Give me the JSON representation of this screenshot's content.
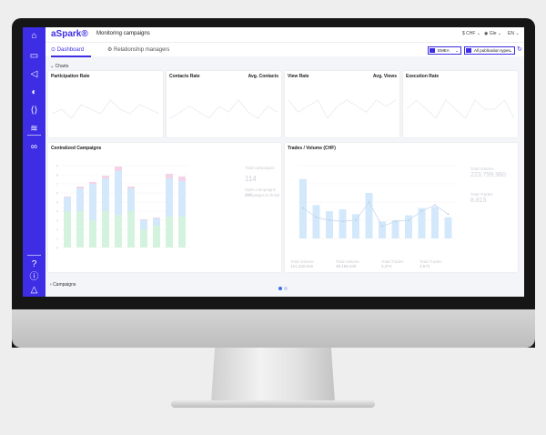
{
  "app": {
    "brand": "aSpark®",
    "page_title": "Monitoring campaigns",
    "currency": "CHF",
    "user": "Gle",
    "language": "EN"
  },
  "sidebar": {
    "icons": [
      "home-icon",
      "book-icon",
      "megaphone-icon",
      "chart-pie-icon",
      "code-icon",
      "analytics-icon",
      "people-icon",
      "help-icon",
      "info-icon",
      "warning-icon"
    ]
  },
  "tabs": [
    {
      "label": "Dashboard",
      "active": true
    },
    {
      "label": "Relationship managers",
      "active": false
    }
  ],
  "filters": {
    "region": "EMEA",
    "publication_types": "All publication types"
  },
  "sections": {
    "charts": "Charts",
    "campaigns": "Campaigns"
  },
  "rate_panels": [
    {
      "title": "Participation Rate",
      "right": ""
    },
    {
      "title": "Contacts Rate",
      "right": "Avg. Contacts"
    },
    {
      "title": "View Rate",
      "right": "Avg. Views"
    },
    {
      "title": "Execution Rate",
      "right": ""
    }
  ],
  "centralized": {
    "title": "Centralized Campaigns",
    "side_label": "Total campaigns",
    "side_value": "114",
    "side_note_1": "Open campaigns and",
    "side_note_2": "campaigns to finish"
  },
  "trades": {
    "title": "Trades / Volume (CHF)",
    "side_label_1": "Total Volume",
    "side_value_1": "223,799,960",
    "side_label_2": "Total Trades",
    "side_value_2": "8,815",
    "stats": [
      {
        "label": "Total Volume",
        "value": "121,232,816"
      },
      {
        "label": "Total Volume",
        "value": "39,155,645"
      },
      {
        "label": "Total Trades",
        "value": "5,374"
      },
      {
        "label": "Total Trades",
        "value": "2,572"
      }
    ]
  },
  "colors": {
    "accent": "#3d2ee6",
    "bar_blue": "#d3e9fb",
    "bar_green": "#d4f3df",
    "bar_pink": "#f3d3e6"
  },
  "chart_data": [
    {
      "type": "bar",
      "title": "Centralized Campaigns",
      "stacked": true,
      "ylim": [
        0,
        9
      ],
      "series": [
        {
          "values": [
            4,
            4,
            3,
            4,
            3.6,
            4,
            2,
            2.4,
            3.4,
            3.4
          ]
        },
        {
          "values": [
            1.5,
            2.5,
            4,
            3.6,
            4.8,
            2.5,
            1,
            0.8,
            4.2,
            3.9
          ]
        },
        {
          "values": [
            0.1,
            0.2,
            0.2,
            0.3,
            0.5,
            0.2,
            0.1,
            0.1,
            0.5,
            0.5
          ]
        }
      ]
    },
    {
      "type": "bar",
      "title": "Trades / Volume (CHF)",
      "bar_values": [
        98,
        55,
        45,
        48,
        40,
        75,
        28,
        30,
        38,
        50,
        52,
        35
      ],
      "line_values": [
        50,
        35,
        30,
        28,
        30,
        60,
        20,
        28,
        30,
        45,
        55,
        40
      ],
      "ylim": [
        0,
        120
      ]
    },
    {
      "type": "line",
      "title": "Participation Rate",
      "values": [
        5,
        6,
        4,
        7,
        6,
        5,
        8,
        6,
        5,
        7,
        6,
        5
      ]
    },
    {
      "type": "line",
      "title": "Contacts Rate",
      "values": [
        4,
        5,
        6,
        5,
        4,
        6,
        5,
        7,
        5,
        4,
        6,
        5
      ]
    },
    {
      "type": "line",
      "title": "View Rate",
      "values": [
        6,
        4,
        5,
        6,
        3,
        5,
        6,
        5,
        4,
        6,
        5,
        6
      ]
    },
    {
      "type": "line",
      "title": "Execution Rate",
      "values": [
        5,
        6,
        5,
        4,
        6,
        5,
        4,
        6,
        5,
        5,
        6,
        4
      ]
    }
  ]
}
